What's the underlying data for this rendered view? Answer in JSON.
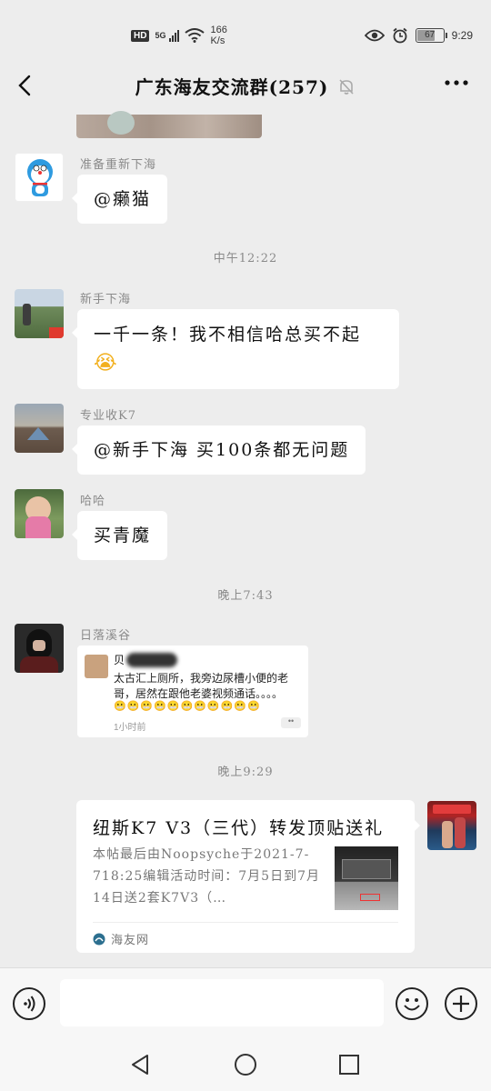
{
  "status_bar": {
    "hd": "HD",
    "signal_label": "5G",
    "net_speed_value": "166",
    "net_speed_unit": "K/s",
    "battery": "67",
    "time": "9:29"
  },
  "header": {
    "title": "广东海友交流群(257)",
    "back_icon": "chevron-left-icon",
    "mute_icon": "bell-off-icon",
    "more_icon": "more-dots-icon"
  },
  "messages": [
    {
      "sender": "准备重新下海",
      "text": "@癞猫"
    },
    {
      "timestamp": "中午12:22"
    },
    {
      "sender": "新手下海",
      "text_line1": "一千一条！我不相信哈总买不起",
      "emoji": "😭"
    },
    {
      "sender": "专业收K7",
      "text": "@新手下海  买100条都无问题"
    },
    {
      "sender": "哈哈",
      "text": "买青魔"
    },
    {
      "timestamp": "晚上7:43"
    },
    {
      "sender": "日落溪谷",
      "quote": {
        "name": "贝",
        "text": "太古汇上厕所，我旁边尿槽小便的老哥，居然在跟他老婆视频通话。。。。",
        "emojis": "😬😬😬😬😬😬😬😬😬😬😬",
        "time": "1小时前"
      }
    },
    {
      "timestamp": "晚上9:29"
    },
    {
      "link": {
        "title": "纽斯K7 V3（三代）转发顶贴送礼",
        "desc": "本帖最后由Noopsyche于2021-7-718:25编辑活动时间：7月5日到7月14日送2套K7V3（…",
        "source": "海友网"
      }
    }
  ],
  "input_bar": {
    "voice_icon": "voice-icon",
    "emoji_icon": "smile-icon",
    "add_icon": "plus-icon"
  },
  "nav_bar": {
    "back_icon": "triangle-back-icon",
    "home_icon": "circle-home-icon",
    "recents_icon": "square-recents-icon"
  }
}
